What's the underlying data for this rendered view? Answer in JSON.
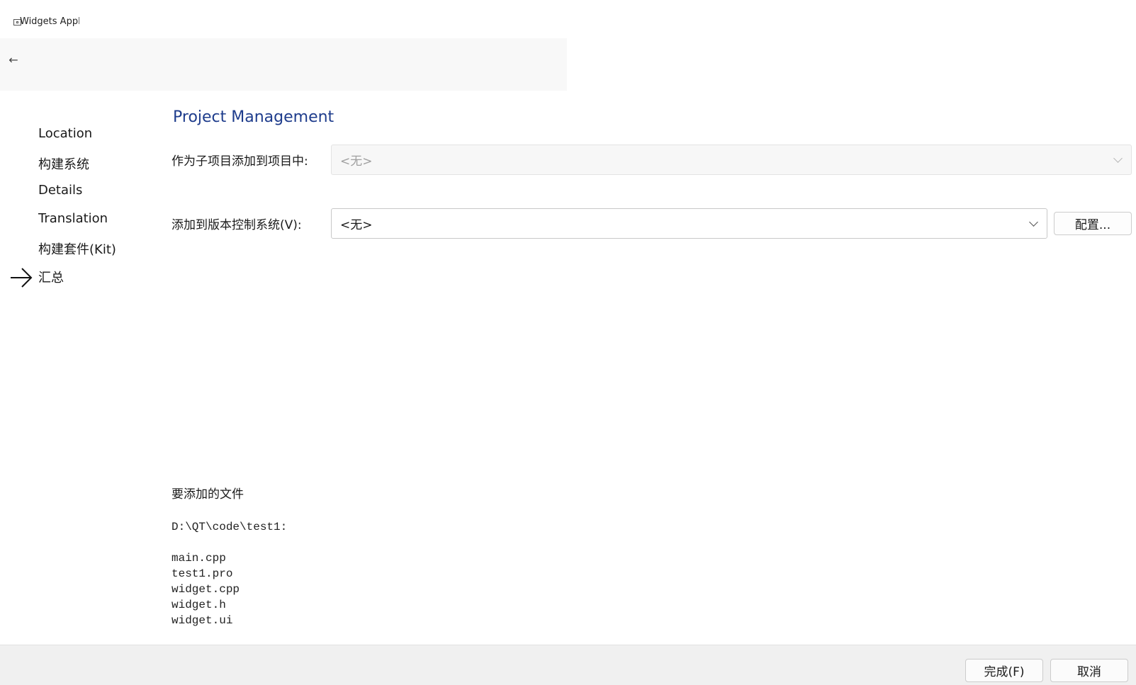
{
  "window": {
    "title": "Widgets Applica"
  },
  "steps": [
    {
      "label": "Location"
    },
    {
      "label": "构建系统"
    },
    {
      "label": "Details"
    },
    {
      "label": "Translation"
    },
    {
      "label": "构建套件(Kit)"
    },
    {
      "label": "汇总"
    }
  ],
  "main": {
    "title": "Project Management",
    "subproject": {
      "label": "作为子项目添加到项目中:",
      "value": "<无>"
    },
    "vcs": {
      "label": "添加到版本控制系统(V):",
      "value": "<无>",
      "configure_label": "配置..."
    },
    "files_heading": "要添加的文件",
    "files_dir": "D:\\QT\\code\\test1:",
    "files": [
      "main.cpp",
      "test1.pro",
      "widget.cpp",
      "widget.h",
      "widget.ui"
    ]
  },
  "footer": {
    "finish_label": "完成(F)",
    "cancel_label": "取消"
  }
}
